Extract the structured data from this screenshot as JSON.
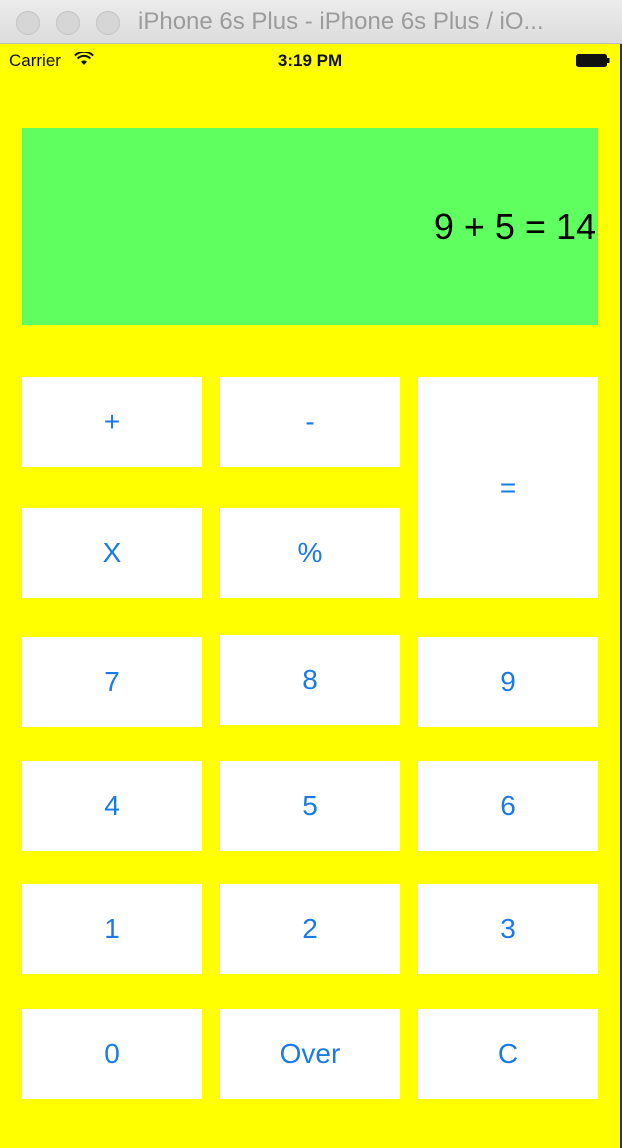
{
  "window": {
    "title": "iPhone 6s Plus - iPhone 6s Plus / iO..."
  },
  "statusbar": {
    "carrier": "Carrier",
    "time": "3:19 PM",
    "icons": [
      "wifi-icon",
      "battery-icon"
    ]
  },
  "display": {
    "text": "9 + 5 = 14"
  },
  "keys": {
    "plus": "+",
    "minus": "-",
    "equals": "=",
    "multiply": "X",
    "percent": "%",
    "seven": "7",
    "eight": "8",
    "nine": "9",
    "four": "4",
    "five": "5",
    "six": "6",
    "one": "1",
    "two": "2",
    "three": "3",
    "zero": "0",
    "over": "Over",
    "clear": "C"
  },
  "colors": {
    "background": "#ffff00",
    "display": "#5fff5f",
    "key_background": "#ffffff",
    "key_text": "#1a7ae8"
  }
}
